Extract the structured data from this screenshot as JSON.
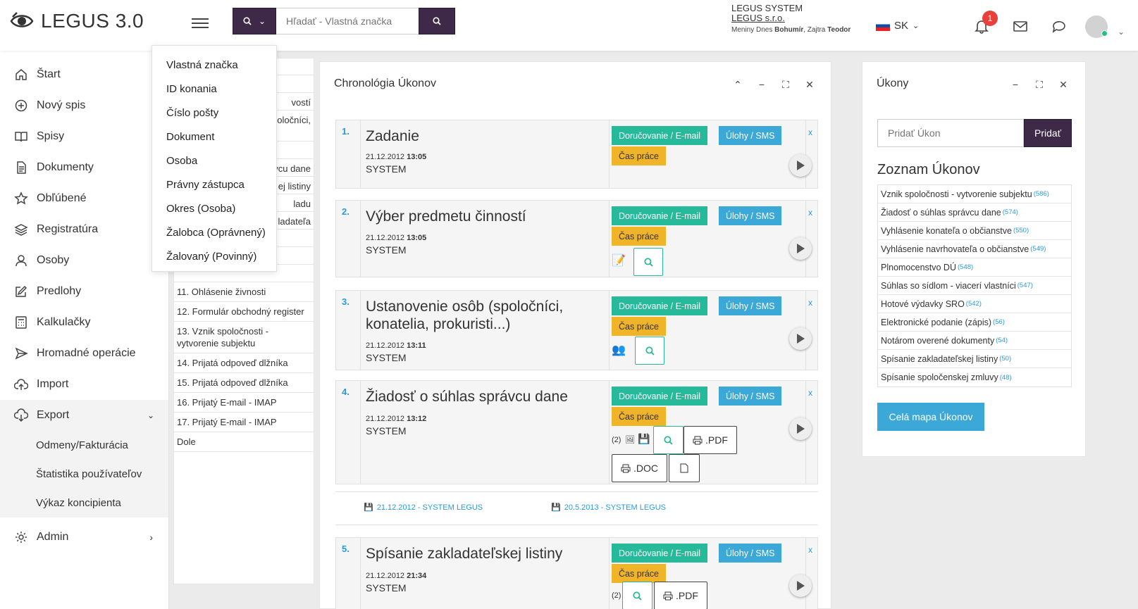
{
  "brand": {
    "name": "LEGUS 3.0"
  },
  "search": {
    "placeholder": "Hľadať - Vlastná značka",
    "menu": [
      "Vlastná značka",
      "ID konania",
      "Číslo pošty",
      "Dokument",
      "Osoba",
      "Právny zástupca",
      "Okres (Osoba)",
      "Žalobca (Oprávnený)",
      "Žalovaný (Povinný)"
    ]
  },
  "system": {
    "line1": "LEGUS SYSTEM",
    "line2": "LEGUS s.r.o.",
    "nameday_prefix": "Meniny Dnes ",
    "nameday_today": "Bohumír",
    "nameday_mid": ", Zajtra ",
    "nameday_tomorrow": "Teodor"
  },
  "lang": {
    "code": "SK"
  },
  "notifications": {
    "count": "1"
  },
  "sidebar": {
    "items": [
      {
        "label": "Štart",
        "icon": "home-icon"
      },
      {
        "label": "Nový spis",
        "icon": "plus-circle-icon"
      },
      {
        "label": "Spisy",
        "icon": "book-icon"
      },
      {
        "label": "Dokumenty",
        "icon": "document-icon"
      },
      {
        "label": "Obľúbené",
        "icon": "star-icon"
      },
      {
        "label": "Registratúra",
        "icon": "layers-icon"
      },
      {
        "label": "Osoby",
        "icon": "user-icon"
      },
      {
        "label": "Predlohy",
        "icon": "edit-icon"
      },
      {
        "label": "Kalkulačky",
        "icon": "calculator-icon"
      },
      {
        "label": "Hromadné operácie",
        "icon": "send-icon"
      },
      {
        "label": "Import",
        "icon": "cloud-upload-icon"
      }
    ],
    "export": {
      "label": "Export",
      "children": [
        "Odmeny/Fakturácia",
        "Štatistika používateľov",
        "Výkaz koncipienta"
      ]
    },
    "admin": {
      "label": "Admin"
    }
  },
  "list_panel": {
    "rows": [
      "",
      "vostí",
      "oločníci,",
      "",
      "vcu dane",
      "ej listiny",
      "ladu",
      "ladateľa",
      "",
      "",
      "",
      "11. Ohlásenie živnosti",
      "12. Formulár obchodný register",
      "13. Vznik spoločnosti - vytvorenie subjektu",
      "14. Prijatá odpoveď dlžníka",
      "15. Prijatá odpoveď dlžníka",
      "16. Prijatý E-mail - IMAP",
      "17. Prijatý E-mail - IMAP",
      "Dole"
    ]
  },
  "chronology": {
    "title": "Chronológia Úkonov",
    "tags": {
      "delivery": "Doručovanie / E-mail",
      "tasks": "Úlohy / SMS",
      "time": "Čas práce"
    },
    "remove": "x",
    "tasks": [
      {
        "num": "1.",
        "name": "Zadanie",
        "date": "21.12.2012",
        "time": "13:05",
        "user": "SYSTEM"
      },
      {
        "num": "2.",
        "name": "Výber predmetu činností",
        "date": "21.12.2012",
        "time": "13:05",
        "user": "SYSTEM"
      },
      {
        "num": "3.",
        "name": "Ustanovenie osôb (spoločníci, konatelia, prokuristi...)",
        "date": "21.12.2012",
        "time": "13:11",
        "user": "SYSTEM"
      },
      {
        "num": "4.",
        "name": "Žiadosť o súhlas správcu dane",
        "date": "21.12.2012",
        "time": "13:12",
        "user": "SYSTEM",
        "attach": "(2)",
        "pdf": ".PDF",
        "doc": ".DOC"
      },
      {
        "num": "5.",
        "name": "Spísanie zakladateľskej listiny",
        "date": "21.12.2012",
        "time": "21:34",
        "user": "SYSTEM",
        "attach": "(2)",
        "pdf": ".PDF"
      }
    ],
    "docs": [
      "21.12.2012 - SYSTEM LEGUS",
      "20.5.2013 - SYSTEM LEGUS"
    ]
  },
  "ukony": {
    "title": "Úkony",
    "add_placeholder": "Pridať Úkon",
    "add_button": "Pridať",
    "list_title": "Zoznam Úkonov",
    "items": [
      {
        "label": "Vznik spoločnosti - vytvorenie subjektu",
        "count": "(586)"
      },
      {
        "label": "Žiadosť o súhlas správcu dane",
        "count": "(574)"
      },
      {
        "label": "Vyhlásenie konateľa o občianstve",
        "count": "(550)"
      },
      {
        "label": "Vyhlásenie navrhovateľa o občianstve",
        "count": "(549)"
      },
      {
        "label": "Plnomocenstvo DÚ",
        "count": "(548)"
      },
      {
        "label": "Súhlas so sídlom - viacerí vlastníci",
        "count": "(547)"
      },
      {
        "label": "Hotové výdavky SRO",
        "count": "(542)"
      },
      {
        "label": "Elektronické podanie (zápis)",
        "count": "(56)"
      },
      {
        "label": "Notárom overené dokumenty",
        "count": "(54)"
      },
      {
        "label": "Spísanie zakladateľskej listiny",
        "count": "(50)"
      },
      {
        "label": "Spísanie spoločenskej zmluvy",
        "count": "(48)"
      }
    ],
    "map_button": "Celá mapa Úkonov"
  },
  "colors": {
    "accent": "#3e2a48",
    "green": "#26b99a",
    "blue": "#3ba8d8",
    "orange": "#f0b429",
    "link": "#2b9ad7"
  }
}
